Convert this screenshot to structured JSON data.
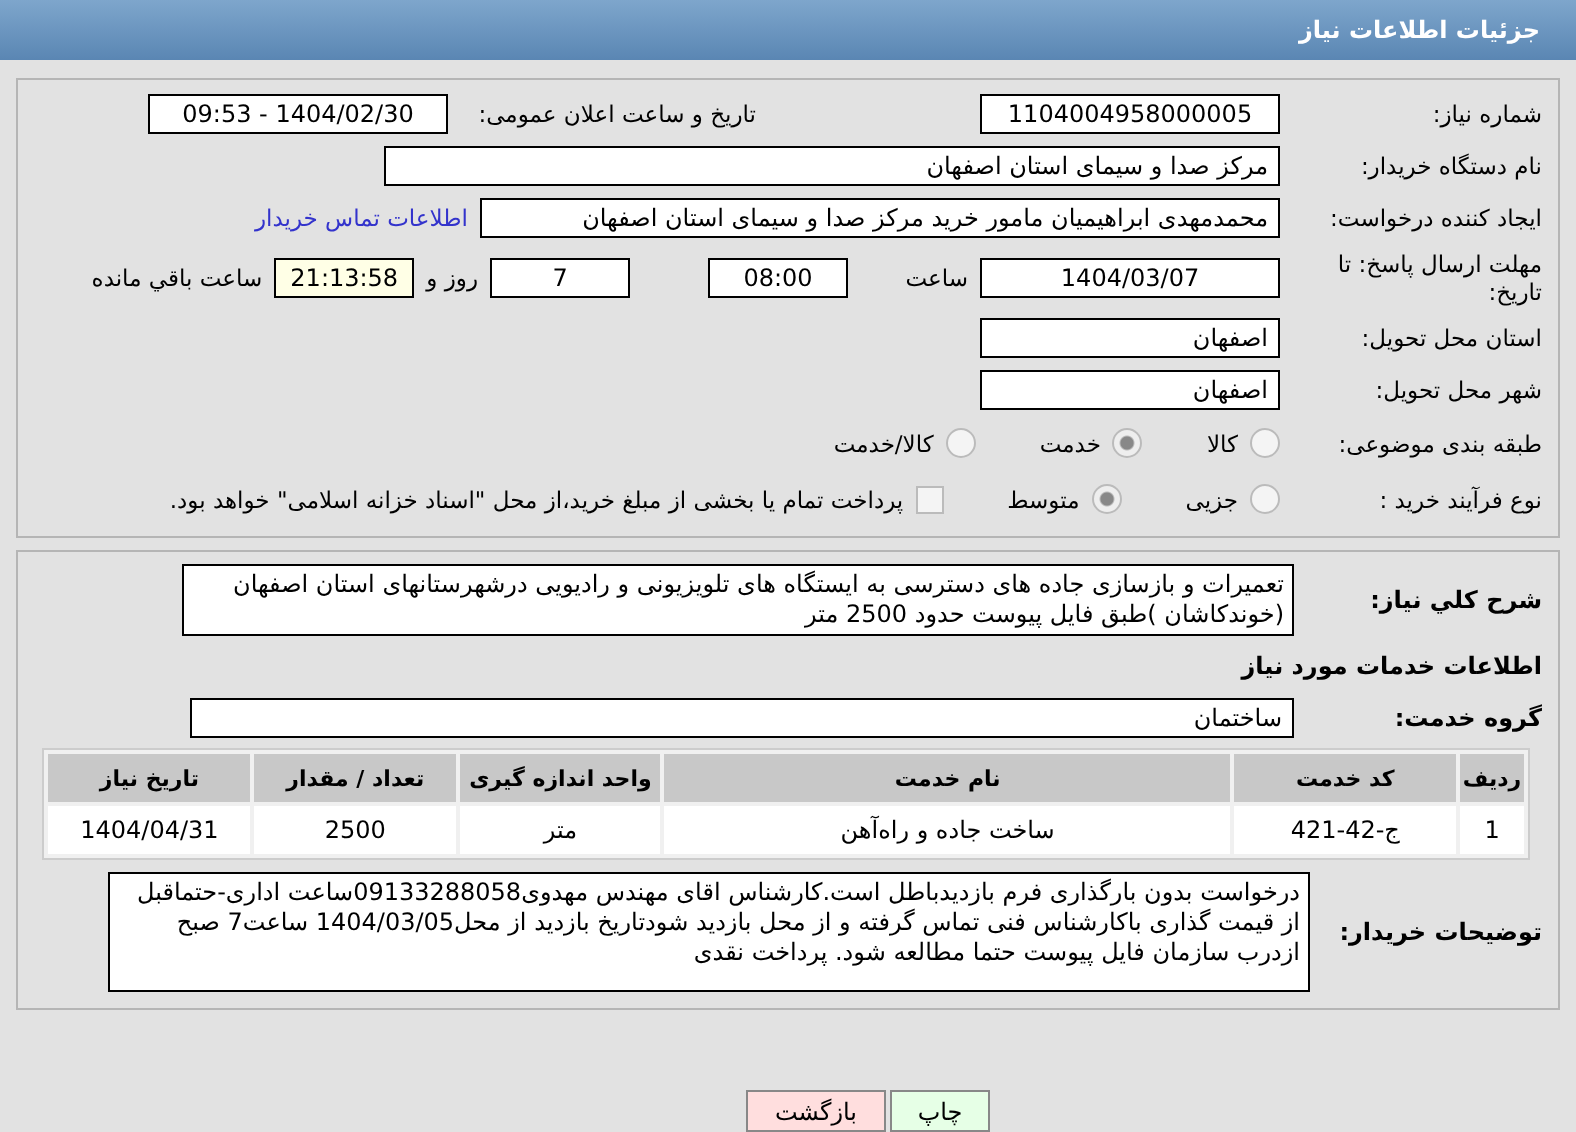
{
  "header": {
    "title": "جزئیات اطلاعات نیاز"
  },
  "details": {
    "need_number": {
      "label": "شماره نیاز:",
      "value": "1104004958000005"
    },
    "announce": {
      "label": "تاریخ و ساعت اعلان عمومی:",
      "value": "1404/02/30 - 09:53"
    },
    "buyer": {
      "label": "نام دستگاه خریدار:",
      "value": "مرکز صدا و سیمای استان اصفهان"
    },
    "creator": {
      "label": "ایجاد کننده درخواست:",
      "value": "محمدمهدی ابراهیمیان مامور خرید مرکز صدا و سیمای استان اصفهان",
      "link": "اطلاعات تماس خریدار"
    },
    "deadline": {
      "label": "مهلت ارسال پاسخ: تا تاریخ:",
      "date": "1404/03/07",
      "time_label": "ساعت",
      "time": "08:00",
      "days": "7",
      "days_label": "روز و",
      "remaining": "21:13:58",
      "remaining_label": "ساعت باقي مانده"
    },
    "province": {
      "label": "استان محل تحویل:",
      "value": "اصفهان"
    },
    "city": {
      "label": "شهر محل تحویل:",
      "value": "اصفهان"
    },
    "category": {
      "label": "طبقه بندی موضوعی:",
      "options": [
        {
          "label": "کالا",
          "selected": false
        },
        {
          "label": "خدمت",
          "selected": true
        },
        {
          "label": "کالا/خدمت",
          "selected": false
        }
      ]
    },
    "process": {
      "label": "نوع فرآیند خرید :",
      "options": [
        {
          "label": "جزیی",
          "selected": false
        },
        {
          "label": "متوسط",
          "selected": true
        }
      ],
      "treasury": {
        "checked": false,
        "text": "پرداخت تمام یا بخشی از مبلغ خرید،از محل \"اسناد خزانه اسلامی\" خواهد بود."
      }
    }
  },
  "services": {
    "description": {
      "label": "شرح کلي نیاز:",
      "value": "تعمیرات و بازسازی جاده های دسترسی به ایستگاه های تلویزیونی و رادیویی درشهرستانهای استان اصفهان (خوندکاشان )طبق فایل پیوست حدود 2500 متر"
    },
    "heading": "اطلاعات خدمات مورد نیاز",
    "group": {
      "label": "گروه خدمت:",
      "value": "ساختمان"
    },
    "table": {
      "columns": [
        "ردیف",
        "کد خدمت",
        "نام خدمت",
        "واحد اندازه گیری",
        "تعداد / مقدار",
        "تاریخ نیاز"
      ],
      "rows": [
        [
          "1",
          "ج-42-421",
          "ساخت جاده و راه‌آهن",
          "متر",
          "2500",
          "1404/04/31"
        ]
      ]
    },
    "notes": {
      "label": "توضیحات خریدار:",
      "value": "درخواست بدون بارگذاری فرم بازدیدباطل است.کارشناس اقای مهندس مهدوی09133288058ساعت اداری-حتماقبل از قیمت گذاری باکارشناس فنی تماس گرفته و از محل بازدید شودتاریخ بازدید از محل1404/03/05 ساعت7 صبح ازدرب سازمان فایل پیوست حتما مطالعه شود. پرداخت نقدی"
    }
  },
  "buttons": [
    {
      "label": "چاپ",
      "kind": "print"
    },
    {
      "label": "بازگشت",
      "kind": "back"
    }
  ]
}
